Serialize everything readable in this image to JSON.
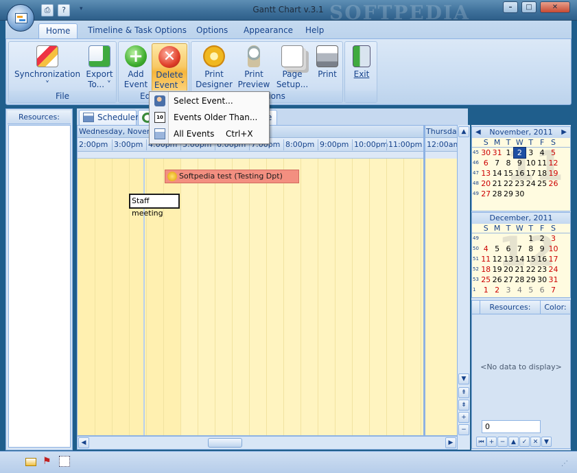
{
  "window": {
    "title": "Gantt Chart v.3.1",
    "watermark": "SOFTPEDIA",
    "controls": {
      "minimize": "–",
      "maximize": "□",
      "close": "✕"
    }
  },
  "ribbon": {
    "tabs": [
      "Home",
      "Timeline & Task Options",
      "Options",
      "Appearance",
      "Help"
    ],
    "groups": {
      "file": {
        "label": "File",
        "buttons": [
          {
            "line1": "Synchronization",
            "line2": "˅"
          },
          {
            "line1": "Export",
            "line2": "To... ˅"
          }
        ]
      },
      "edit": {
        "label": "Ed",
        "buttons": [
          {
            "line1": "Add",
            "line2": "Event"
          },
          {
            "line1": "Delete",
            "line2": "Event ˅"
          }
        ]
      },
      "print": {
        "label": "ptions",
        "buttons": [
          {
            "line1": "Print",
            "line2": "Designer"
          },
          {
            "line1": "Print",
            "line2": "Preview"
          },
          {
            "line1": "Page",
            "line2": "Setup..."
          },
          {
            "line1": "Print",
            "line2": ""
          }
        ]
      },
      "exit": {
        "label": "",
        "buttons": [
          {
            "line1": "Exit",
            "line2": ""
          }
        ]
      }
    }
  },
  "delete_menu": {
    "items": [
      {
        "label": "Select Event...",
        "shortcut": "",
        "icon": "user-delete-icon"
      },
      {
        "label": "Events Older Than...",
        "shortcut": "",
        "icon": "calendar-10-delete-icon"
      },
      {
        "label": "All Events",
        "shortcut": "Ctrl+X",
        "icon": "grid-delete-icon"
      }
    ]
  },
  "left_panel": {
    "header": "Resources:"
  },
  "scheduler": {
    "tabs": [
      "Scheduler",
      "",
      "e"
    ],
    "date_header": "Wednesday, Novemb",
    "times": [
      "2:00pm",
      "3:00pm",
      "4:00pm",
      "5:00pm",
      "6:00pm",
      "7:00pm",
      "8:00pm",
      "9:00pm",
      "10:00pm",
      "11:00pm"
    ],
    "events": [
      {
        "title": "Softpedia test (Testing Dpt)",
        "color": "#f38f80"
      },
      {
        "title": "Staff meeting",
        "color": "#ffffff"
      }
    ],
    "next_day": {
      "header": "Thursday",
      "time": "12:00am"
    }
  },
  "calendars": [
    {
      "title": "November, 2011",
      "big_number": "11",
      "dow": [
        "S",
        "M",
        "T",
        "W",
        "T",
        "F",
        "S"
      ],
      "weeks": [
        {
          "wk": "45",
          "days": [
            "30",
            "31",
            "1",
            "2",
            "3",
            "4",
            "5"
          ]
        },
        {
          "wk": "46",
          "days": [
            "6",
            "7",
            "8",
            "9",
            "10",
            "11",
            "12"
          ]
        },
        {
          "wk": "47",
          "days": [
            "13",
            "14",
            "15",
            "16",
            "17",
            "18",
            "19"
          ]
        },
        {
          "wk": "48",
          "days": [
            "20",
            "21",
            "22",
            "23",
            "24",
            "25",
            "26"
          ]
        },
        {
          "wk": "49",
          "days": [
            "27",
            "28",
            "29",
            "30",
            "",
            "",
            ""
          ]
        }
      ],
      "today": "2"
    },
    {
      "title": "December, 2011",
      "big_number": "12",
      "dow": [
        "S",
        "M",
        "T",
        "W",
        "T",
        "F",
        "S"
      ],
      "weeks": [
        {
          "wk": "49",
          "days": [
            "",
            "",
            "",
            "",
            "1",
            "2",
            "3"
          ]
        },
        {
          "wk": "50",
          "days": [
            "4",
            "5",
            "6",
            "7",
            "8",
            "9",
            "10"
          ]
        },
        {
          "wk": "51",
          "days": [
            "11",
            "12",
            "13",
            "14",
            "15",
            "16",
            "17"
          ]
        },
        {
          "wk": "52",
          "days": [
            "18",
            "19",
            "20",
            "21",
            "22",
            "23",
            "24"
          ]
        },
        {
          "wk": "53",
          "days": [
            "25",
            "26",
            "27",
            "28",
            "29",
            "30",
            "31"
          ]
        },
        {
          "wk": "1",
          "days": [
            "1",
            "2",
            "3",
            "4",
            "5",
            "6",
            "7"
          ]
        }
      ],
      "today": ""
    }
  ],
  "resource_grid": {
    "col1": "Resources:",
    "col2": "Color:",
    "empty": "<No data to display>",
    "record": "0"
  }
}
